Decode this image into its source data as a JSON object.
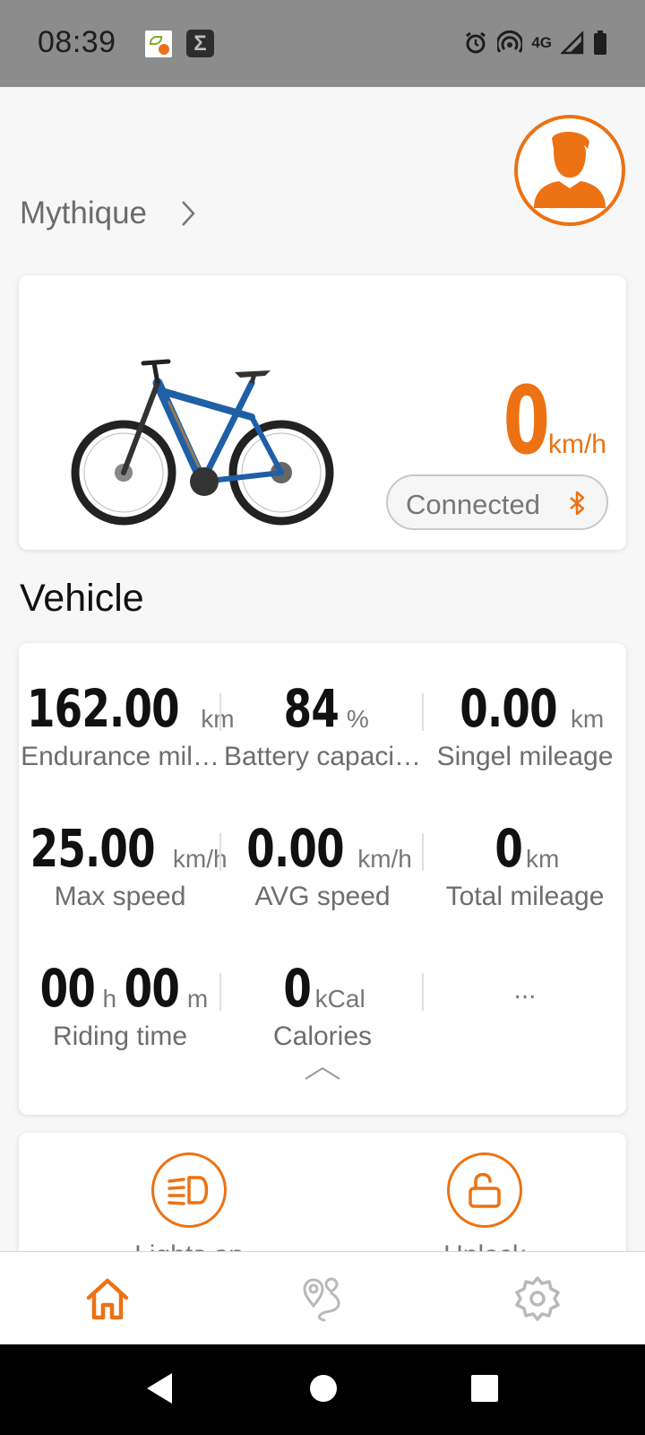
{
  "status_bar": {
    "time": "08:39",
    "network": "4G",
    "icons": [
      "notification-app-icon",
      "sigma-app-icon",
      "alarm-icon",
      "hotspot-icon",
      "signal-icon",
      "battery-icon"
    ]
  },
  "header": {
    "device_name": "Mythique",
    "icons": [
      "chevron-right-icon",
      "user-avatar-icon"
    ]
  },
  "bike_card": {
    "speed_value": "0",
    "speed_unit": "km/h",
    "connection_status": "Connected",
    "connection_icon": "bluetooth-icon"
  },
  "vehicle": {
    "section_title": "Vehicle",
    "stats": [
      {
        "value": "162.00",
        "unit": "km",
        "label": "Endurance mil…"
      },
      {
        "value": "84",
        "unit": "%",
        "label": "Battery capaci…"
      },
      {
        "value": "0.00",
        "unit": "km",
        "label": "Singel mileage"
      },
      {
        "value": "25.00",
        "unit": "km/h",
        "label": "Max speed"
      },
      {
        "value": "0.00",
        "unit": "km/h",
        "label": "AVG speed"
      },
      {
        "value": "0",
        "unit": "km",
        "label": "Total mileage"
      },
      {
        "value_h": "00",
        "unit_h": "h",
        "value_m": "00",
        "unit_m": "m",
        "label": "Riding time"
      },
      {
        "value": "0",
        "unit": "kCal",
        "label": "Calories"
      },
      {
        "more": "..."
      }
    ]
  },
  "controls": [
    {
      "label": "Lights on",
      "icon": "headlight-icon"
    },
    {
      "label": "Unlock",
      "icon": "unlock-icon"
    }
  ],
  "bottom_nav": [
    "home-icon",
    "route-map-icon",
    "settings-gear-icon"
  ],
  "colors": {
    "accent": "#ec7213",
    "status_bar": "#8c8c8c",
    "background": "#f7f7f7",
    "bike_blue": "#1f5fa6"
  }
}
